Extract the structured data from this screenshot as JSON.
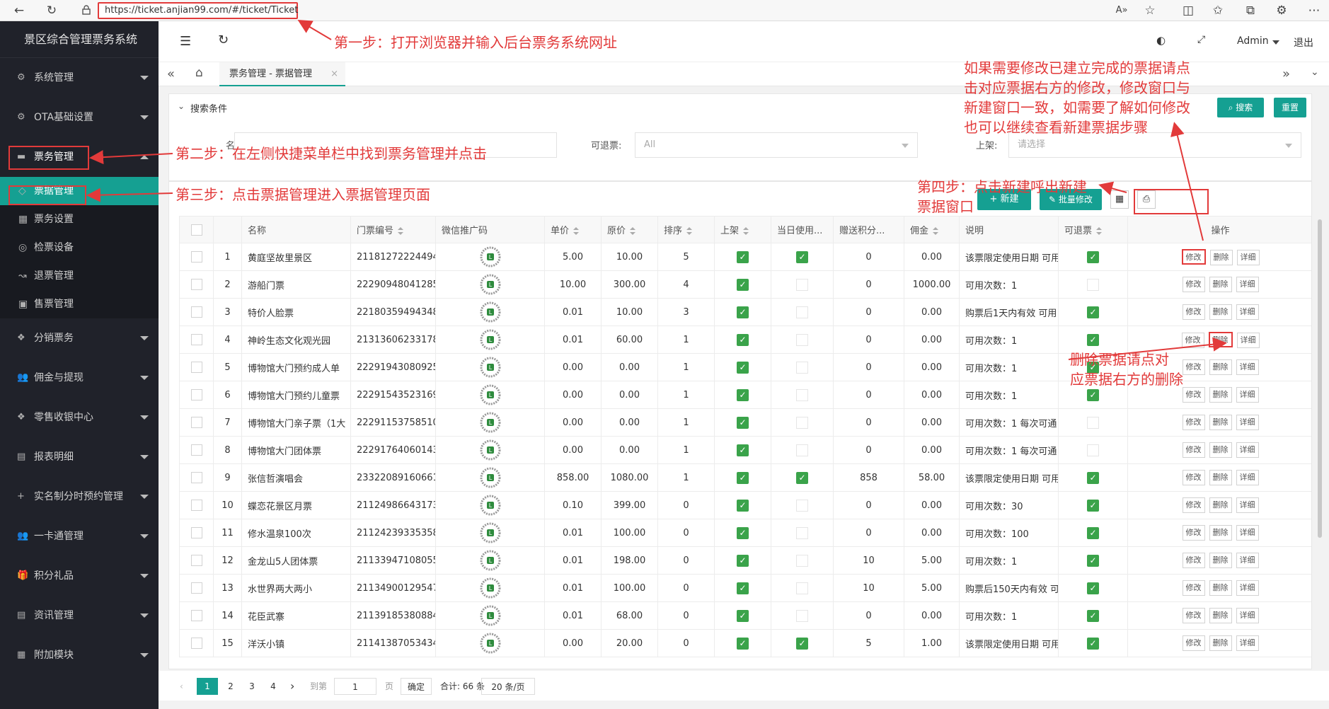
{
  "browser": {
    "url": "https://ticket.anjian99.com/#/ticket/Ticket"
  },
  "app": {
    "title": "景区综合管理票务系统",
    "user": "Admin",
    "logout": "退出"
  },
  "sidebar": {
    "items": [
      {
        "label": "系统管理"
      },
      {
        "label": "OTA基础设置"
      },
      {
        "label": "票务管理"
      },
      {
        "label": "分销票务"
      },
      {
        "label": "佣金与提现"
      },
      {
        "label": "零售收银中心"
      },
      {
        "label": "报表明细"
      },
      {
        "label": "实名制分时预约管理"
      },
      {
        "label": "一卡通管理"
      },
      {
        "label": "积分礼品"
      },
      {
        "label": "资讯管理"
      },
      {
        "label": "附加模块"
      }
    ],
    "sub_items": [
      {
        "label": "票据管理"
      },
      {
        "label": "票务设置"
      },
      {
        "label": "检票设备"
      },
      {
        "label": "退票管理"
      },
      {
        "label": "售票管理"
      }
    ]
  },
  "tab": {
    "label": "票务管理 - 票据管理",
    "close": "×"
  },
  "search": {
    "title": "搜索条件",
    "name_label": "名称:",
    "refund_label": "可退票:",
    "refund_value": "All",
    "shelf_label": "上架:",
    "shelf_placeholder": "请选择",
    "search_btn": "搜索",
    "reset_btn": "重置"
  },
  "toolbar": {
    "new_btn": "+ 新建",
    "batch_btn": "批量修改"
  },
  "table": {
    "headers": [
      "名称",
      "门票编号",
      "微信推广码",
      "单价",
      "原价",
      "排序",
      "上架",
      "当日使用...",
      "赠送积分...",
      "佣金",
      "说明",
      "可退票",
      "操作"
    ],
    "actions": {
      "edit": "修改",
      "delete": "删除",
      "detail": "详细"
    },
    "rows": [
      {
        "no": "1",
        "name": "黄庭坚故里景区",
        "code": "21181272224494",
        "price": "5.00",
        "orig": "10.00",
        "sort": "5",
        "shelf": true,
        "today": true,
        "points": "0",
        "comm": "0.00",
        "desc": "该票限定使用日期 可用",
        "refund": true
      },
      {
        "no": "2",
        "name": "游船门票",
        "code": "22290948041285",
        "price": "10.00",
        "orig": "300.00",
        "sort": "4",
        "shelf": true,
        "today": false,
        "points": "0",
        "comm": "1000.00",
        "desc": "可用次数：1",
        "refund": false
      },
      {
        "no": "3",
        "name": "特价人脸票",
        "code": "22180359494348",
        "price": "0.01",
        "orig": "10.00",
        "sort": "3",
        "shelf": true,
        "today": false,
        "points": "0",
        "comm": "0.00",
        "desc": "购票后1天内有效 可用",
        "refund": true
      },
      {
        "no": "4",
        "name": "神岭生态文化观光园",
        "code": "21313606233178",
        "price": "0.01",
        "orig": "60.00",
        "sort": "1",
        "shelf": true,
        "today": false,
        "points": "0",
        "comm": "0.00",
        "desc": "可用次数：1",
        "refund": true
      },
      {
        "no": "5",
        "name": "博物馆大门预约成人单",
        "code": "22291943080925",
        "price": "0.00",
        "orig": "0.00",
        "sort": "1",
        "shelf": true,
        "today": false,
        "points": "0",
        "comm": "0.00",
        "desc": "可用次数：1",
        "refund": true
      },
      {
        "no": "6",
        "name": "博物馆大门预约儿童票",
        "code": "22291543523169",
        "price": "0.00",
        "orig": "0.00",
        "sort": "1",
        "shelf": true,
        "today": false,
        "points": "0",
        "comm": "0.00",
        "desc": "可用次数：1",
        "refund": true
      },
      {
        "no": "7",
        "name": "博物馆大门亲子票（1大",
        "code": "22291153758510",
        "price": "0.00",
        "orig": "0.00",
        "sort": "1",
        "shelf": true,
        "today": false,
        "points": "0",
        "comm": "0.00",
        "desc": "可用次数：1 每次可通",
        "refund": false
      },
      {
        "no": "8",
        "name": "博物馆大门团体票",
        "code": "22291764060143",
        "price": "0.00",
        "orig": "0.00",
        "sort": "1",
        "shelf": true,
        "today": false,
        "points": "0",
        "comm": "0.00",
        "desc": "可用次数：1 每次可通",
        "refund": false
      },
      {
        "no": "9",
        "name": "张信哲演唱会",
        "code": "23322089160661",
        "price": "858.00",
        "orig": "1080.00",
        "sort": "1",
        "shelf": true,
        "today": true,
        "points": "858",
        "comm": "58.00",
        "desc": "该票限定使用日期 可用",
        "refund": true
      },
      {
        "no": "10",
        "name": "蝶恋花景区月票",
        "code": "21124986643173",
        "price": "0.10",
        "orig": "399.00",
        "sort": "0",
        "shelf": true,
        "today": false,
        "points": "0",
        "comm": "0.00",
        "desc": "可用次数：30",
        "refund": true
      },
      {
        "no": "11",
        "name": "修水温泉100次",
        "code": "21124239335358",
        "price": "0.01",
        "orig": "100.00",
        "sort": "0",
        "shelf": true,
        "today": false,
        "points": "0",
        "comm": "0.00",
        "desc": "可用次数：100",
        "refund": true
      },
      {
        "no": "12",
        "name": "金龙山5人团体票",
        "code": "21133947108055",
        "price": "0.01",
        "orig": "198.00",
        "sort": "0",
        "shelf": true,
        "today": false,
        "points": "10",
        "comm": "5.00",
        "desc": "可用次数：1",
        "refund": true
      },
      {
        "no": "13",
        "name": "水世界两大两小",
        "code": "21134900129547",
        "price": "0.01",
        "orig": "100.00",
        "sort": "0",
        "shelf": true,
        "today": false,
        "points": "10",
        "comm": "5.00",
        "desc": "购票后150天内有效 可",
        "refund": true
      },
      {
        "no": "14",
        "name": "花臣武寨",
        "code": "21139185380884",
        "price": "0.01",
        "orig": "68.00",
        "sort": "0",
        "shelf": true,
        "today": false,
        "points": "0",
        "comm": "0.00",
        "desc": "可用次数：1",
        "refund": true
      },
      {
        "no": "15",
        "name": "洋沃小镇",
        "code": "21141387053434",
        "price": "0.00",
        "orig": "20.00",
        "sort": "0",
        "shelf": true,
        "today": true,
        "points": "5",
        "comm": "1.00",
        "desc": "该票限定使用日期 可用",
        "refund": true
      }
    ]
  },
  "pager": {
    "pages": [
      "1",
      "2",
      "3",
      "4"
    ],
    "goto": "到第",
    "page_input": "1",
    "page_unit": "页",
    "confirm": "确定",
    "total": "合计: 66 条",
    "page_size": "20 条/页"
  },
  "annotations": {
    "step1": "第一步：打开浏览器并输入后台票务系统网址",
    "step2": "第二步：在左侧快捷菜单栏中找到票务管理并点击",
    "step3": "第三步：点击票据管理进入票据管理页面",
    "step4a": "第四步：点击新建呼出新建",
    "step4b": "票据窗口",
    "edit_note": [
      "如果需要修改已建立完成的票据请点",
      "击对应票据右方的修改，修改窗口与",
      "新建窗口一致，如需要了解如何修改",
      "也可以继续查看新建票据步骤"
    ],
    "delete_note": [
      "删除票据请点对",
      "应票据右方的删除"
    ]
  },
  "colors": {
    "accent": "#15a092",
    "annotation": "#e23a3a",
    "sidebar": "#20222a"
  }
}
